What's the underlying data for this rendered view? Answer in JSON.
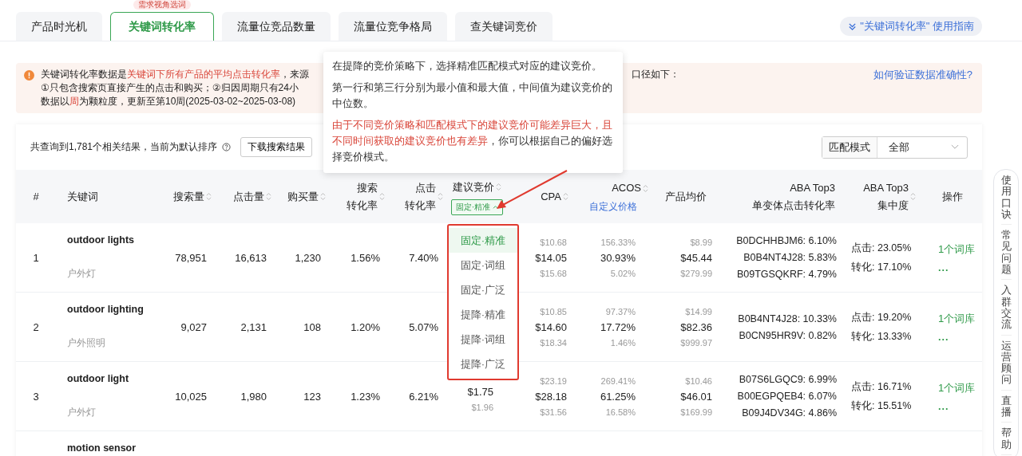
{
  "tabs": [
    {
      "label": "产品时光机",
      "selected": false
    },
    {
      "label": "关键词转化率",
      "selected": true
    },
    {
      "label": "流量位竞品数量",
      "selected": false
    },
    {
      "label": "流量位竞争格局",
      "selected": false
    },
    {
      "label": "查关键词竞价",
      "selected": false
    }
  ],
  "tab_badge": "需求视角选词",
  "guide_link": "\"关键词转化率\" 使用指南",
  "alert": {
    "lines": [
      [
        {
          "text": "关键词转化率数据是",
          "highlight": false
        },
        {
          "text": "关键词下所有产品的平均点击转化率",
          "highlight": true
        },
        {
          "text": "，来源",
          "highlight": false
        }
      ],
      [
        {
          "text": "①只包含搜索页直接产生的点击和购买；②归因周期只有24小",
          "highlight": false
        }
      ],
      [
        {
          "text": "数据以",
          "highlight": false
        },
        {
          "text": "周",
          "highlight": true
        },
        {
          "text": "为颗粒度，更新至第10周(2025-03-02~2025-03-08)",
          "highlight": false
        }
      ]
    ],
    "continuation": "口径如下：",
    "link": "如何验证数据准确性?"
  },
  "toolbar": {
    "summary": "共查询到1,781个相关结果，当前为默认排序",
    "download_button": "下载搜索结果",
    "match_label": "匹配模式",
    "match_value": "全部"
  },
  "tooltip": {
    "paragraphs": [
      [
        {
          "text": "在提降的竞价策略下，选择精准匹配模式对应的建议竞价。",
          "highlight": false
        }
      ],
      [
        {
          "text": "第一行和第三行分别为最小值和最大值，中间值为建议竞价的中位数。",
          "highlight": false
        }
      ],
      [
        {
          "text": "由于不同竞价策略和匹配模式下的建议竞价可能差异巨大，且不同时间获取的建议竞价也有差异",
          "highlight": true
        },
        {
          "text": "，你可以根据自己的偏好选择竞价模式。",
          "highlight": false
        }
      ]
    ]
  },
  "columns": [
    {
      "lines": [
        "#"
      ],
      "sortable": false
    },
    {
      "lines": [
        "关键词"
      ],
      "sortable": false
    },
    {
      "lines": [
        "搜索量"
      ],
      "sortable": true
    },
    {
      "lines": [
        "点击量"
      ],
      "sortable": true
    },
    {
      "lines": [
        "购买量"
      ],
      "sortable": true
    },
    {
      "lines": [
        "搜索",
        "转化率"
      ],
      "sortable": true
    },
    {
      "lines": [
        "点击",
        "转化率"
      ],
      "sortable": true
    },
    {
      "lines": [
        "建议竞价"
      ],
      "sortable": true,
      "tag": "固定·精准"
    },
    {
      "lines": [
        "CPA"
      ],
      "sortable": true
    },
    {
      "lines": [
        "ACOS"
      ],
      "sortable": true,
      "link": "自定义价格"
    },
    {
      "lines": [
        "产品均价"
      ],
      "sortable": false
    },
    {
      "lines": [
        "ABA Top3",
        "单变体点击转化率"
      ],
      "sortable": false
    },
    {
      "lines": [
        "ABA Top3",
        "集中度"
      ],
      "sortable": true
    },
    {
      "lines": [
        "操作"
      ],
      "sortable": false
    }
  ],
  "rows": [
    {
      "index": "1",
      "keyword": "outdoor lights",
      "keyword_cn": "户外灯",
      "search": "78,951",
      "clicks": "16,613",
      "purchases": "1,230",
      "search_cvr": "1.56%",
      "click_cvr": "7.40%",
      "cpa": {
        "min": "$10.68",
        "median": "$14.05",
        "max": "$15.68"
      },
      "acos": {
        "min": "156.33%",
        "median": "30.93%",
        "max": "5.02%"
      },
      "price": {
        "min": "$8.99",
        "median": "$45.44",
        "max": "$279.99"
      },
      "aba": [
        "B0DCHHBJM6: 6.10%",
        "B0B4NT4J28: 5.83%",
        "B09TGSQKRF: 4.79%"
      ],
      "concentration": [
        "点击: 23.05%",
        "转化: 17.10%"
      ],
      "action": "1个词库",
      "more": "..."
    },
    {
      "index": "2",
      "keyword": "outdoor lighting",
      "keyword_cn": "户外照明",
      "search": "9,027",
      "clicks": "2,131",
      "purchases": "108",
      "search_cvr": "1.20%",
      "click_cvr": "5.07%",
      "cpa": {
        "min": "$10.85",
        "median": "$14.60",
        "max": "$18.34"
      },
      "acos": {
        "min": "97.37%",
        "median": "17.72%",
        "max": "1.46%"
      },
      "price": {
        "min": "$14.99",
        "median": "$82.36",
        "max": "$999.97"
      },
      "aba": [
        "B0B4NT4J28: 10.33%",
        "B0CN95HR9V: 0.82%"
      ],
      "concentration": [
        "点击: 19.20%",
        "转化: 13.33%"
      ],
      "action": "1个词库",
      "more": "..."
    },
    {
      "index": "3",
      "keyword": "outdoor light",
      "keyword_cn": "户外灯",
      "search": "10,025",
      "clicks": "1,980",
      "purchases": "123",
      "search_cvr": "1.23%",
      "click_cvr": "6.21%",
      "bid": {
        "median": "$1.75",
        "max": "$1.96"
      },
      "cpa": {
        "min": "$23.19",
        "median": "$28.18",
        "max": "$31.56"
      },
      "acos": {
        "min": "269.41%",
        "median": "61.25%",
        "max": "16.58%"
      },
      "price": {
        "min": "$10.46",
        "median": "$46.01",
        "max": "$169.99"
      },
      "aba": [
        "B07S6LGQC9: 6.99%",
        "B00EGPQEB4: 6.07%",
        "B09J4DV34G: 4.86%"
      ],
      "concentration": [
        "点击: 16.71%",
        "转化: 15.51%"
      ],
      "action": "1个词库",
      "more": "..."
    },
    {
      "keyword": "motion sensor"
    }
  ],
  "bid_menu": [
    {
      "label": "固定·精准",
      "selected": true
    },
    {
      "label": "固定·词组",
      "selected": false
    },
    {
      "label": "固定·广泛",
      "selected": false
    },
    {
      "label": "提降·精准",
      "selected": false
    },
    {
      "label": "提降·词组",
      "selected": false
    },
    {
      "label": "提降·广泛",
      "selected": false
    }
  ],
  "side_panel": [
    "使用口诀",
    "常见问题",
    "入群交流",
    "运营顾问",
    "直播",
    "帮助"
  ]
}
